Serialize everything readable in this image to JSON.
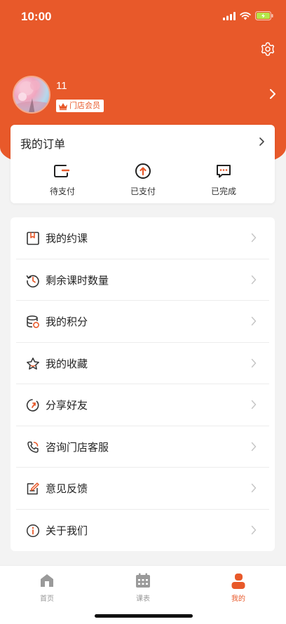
{
  "status_bar": {
    "time": "10:00"
  },
  "profile": {
    "username": "11",
    "badge": "门店会员"
  },
  "orders": {
    "title": "我的订单",
    "items": [
      {
        "label": "待支付",
        "icon": "pending-payment-icon"
      },
      {
        "label": "已支付",
        "icon": "paid-icon"
      },
      {
        "label": "已完成",
        "icon": "completed-icon"
      }
    ]
  },
  "menu": {
    "items": [
      {
        "label": "我的约课",
        "icon": "booking-icon"
      },
      {
        "label": "剩余课时数量",
        "icon": "history-icon"
      },
      {
        "label": "我的积分",
        "icon": "points-icon"
      },
      {
        "label": "我的收藏",
        "icon": "star-icon"
      },
      {
        "label": "分享好友",
        "icon": "share-icon"
      },
      {
        "label": "咨询门店客服",
        "icon": "phone-icon"
      },
      {
        "label": "意见反馈",
        "icon": "feedback-icon"
      },
      {
        "label": "关于我们",
        "icon": "info-icon"
      }
    ]
  },
  "tabbar": {
    "items": [
      {
        "label": "首页",
        "icon": "home-icon",
        "active": false
      },
      {
        "label": "课表",
        "icon": "calendar-icon",
        "active": false
      },
      {
        "label": "我的",
        "icon": "user-icon",
        "active": true
      }
    ]
  },
  "colors": {
    "accent": "#e8592a",
    "inactive": "#999999"
  }
}
